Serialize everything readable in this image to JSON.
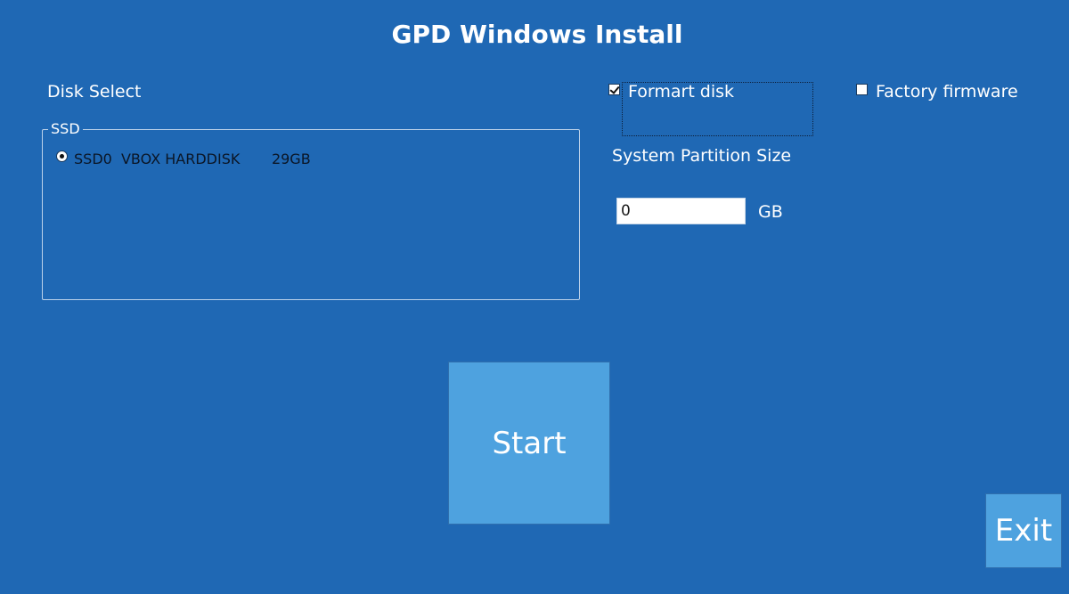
{
  "window": {
    "title": "GPD Windows Install"
  },
  "disk_select": {
    "label": "Disk Select",
    "group_label": "SSD",
    "disks": [
      {
        "id": "SSD0",
        "model": "VBOX HARDDISK",
        "size": "29GB",
        "display": "SSD0  VBOX HARDDISK       29GB",
        "selected": true
      }
    ]
  },
  "options": {
    "format_disk": {
      "label": "Formart disk",
      "checked": true
    },
    "factory_firmware": {
      "label": "Factory firmware",
      "checked": false
    }
  },
  "partition": {
    "label": "System Partition Size",
    "value": "0",
    "unit": "GB"
  },
  "actions": {
    "start_label": "Start",
    "exit_label": "Exit"
  },
  "colors": {
    "background": "#1f68b4",
    "button": "#4ea2df",
    "text": "#ffffff"
  }
}
